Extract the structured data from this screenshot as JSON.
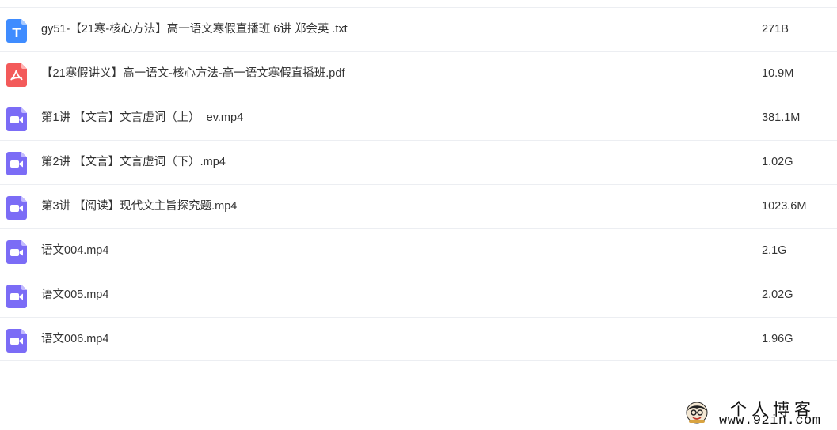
{
  "colors": {
    "txt_icon": "#3f8cff",
    "pdf_icon": "#f35a5a",
    "video_icon": "#7b6cf6",
    "row_divider": "#eceef2",
    "text": "#333333"
  },
  "files": [
    {
      "icon": "txt-file-icon",
      "name": "gy51-【21寒-核心方法】高一语文寒假直播班 6讲 郑会英 .txt",
      "size": "271B"
    },
    {
      "icon": "pdf-file-icon",
      "name": "【21寒假讲义】高一语文-核心方法-高一语文寒假直播班.pdf",
      "size": "10.9M"
    },
    {
      "icon": "video-file-icon",
      "name": "第1讲 【文言】文言虚词（上）_ev.mp4",
      "size": "381.1M"
    },
    {
      "icon": "video-file-icon",
      "name": "第2讲 【文言】文言虚词（下）.mp4",
      "size": "1.02G"
    },
    {
      "icon": "video-file-icon",
      "name": "第3讲 【阅读】现代文主旨探究题.mp4",
      "size": "1023.6M"
    },
    {
      "icon": "video-file-icon",
      "name": "语文004.mp4",
      "size": "2.1G"
    },
    {
      "icon": "video-file-icon",
      "name": "语文005.mp4",
      "size": "2.02G"
    },
    {
      "icon": "video-file-icon",
      "name": "语文006.mp4",
      "size": "1.96G"
    }
  ],
  "watermark": {
    "title": "个人博客",
    "url": "www.92in.com"
  }
}
